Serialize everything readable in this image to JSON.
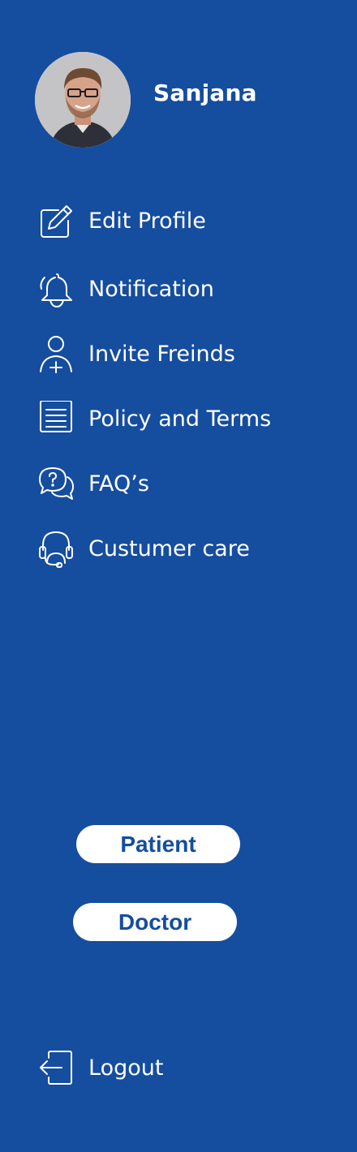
{
  "profile": {
    "name": "Sanjana"
  },
  "menu": [
    {
      "label": "Edit Profile",
      "icon": "edit-icon"
    },
    {
      "label": "Notification",
      "icon": "bell-icon"
    },
    {
      "label": "Invite Freinds",
      "icon": "add-user-icon"
    },
    {
      "label": "Policy and Terms",
      "icon": "document-icon"
    },
    {
      "label": "FAQ’s",
      "icon": "faq-icon"
    },
    {
      "label": "Custumer care",
      "icon": "headset-icon"
    }
  ],
  "roles": {
    "patient_label": "Patient",
    "doctor_label": "Doctor"
  },
  "logout": {
    "label": "Logout",
    "icon": "logout-icon"
  },
  "colors": {
    "background": "#154d9f",
    "text": "#ffffff",
    "button_bg": "#ffffff",
    "button_text": "#154d9f"
  }
}
